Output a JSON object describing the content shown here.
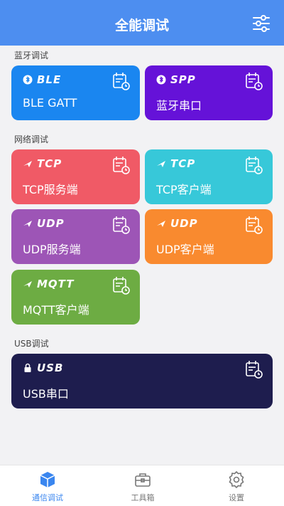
{
  "header": {
    "title": "全能调试",
    "settings_icon": "sliders-icon"
  },
  "sections": {
    "bluetooth": "蓝牙调试",
    "network": "网络调试",
    "usb": "USB调试"
  },
  "cards": [
    {
      "tag": "BLE",
      "label": "BLE GATT",
      "color": "#1a86f0",
      "icon": "bluetooth-icon"
    },
    {
      "tag": "SPP",
      "label": "蓝牙串口",
      "color": "#6512d8",
      "icon": "bluetooth-icon"
    },
    {
      "tag": "TCP",
      "label": "TCP服务端",
      "color": "#f05a66",
      "icon": "tcp-plane-icon"
    },
    {
      "tag": "TCP",
      "label": "TCP客户端",
      "color": "#37c8d9",
      "icon": "tcp-plane-icon"
    },
    {
      "tag": "UDP",
      "label": "UDP服务端",
      "color": "#9d55b6",
      "icon": "udp-plane-icon"
    },
    {
      "tag": "UDP",
      "label": "UDP客户端",
      "color": "#f98a2f",
      "icon": "udp-plane-icon"
    },
    {
      "tag": "MQTT",
      "label": "MQTT客户端",
      "color": "#6dac43",
      "icon": "mqtt-plane-icon"
    },
    {
      "tag": "USB",
      "label": "USB串口",
      "color": "#1e1d4e",
      "icon": "lock-icon"
    }
  ],
  "nav": [
    {
      "label": "通信调试",
      "active": true,
      "icon": "cube-icon"
    },
    {
      "label": "工具箱",
      "active": false,
      "icon": "toolbox-icon"
    },
    {
      "label": "设置",
      "active": false,
      "icon": "gear-icon"
    }
  ],
  "colors": {
    "header": "#4d8ef0",
    "accent": "#3a86ef",
    "background": "#f2f2f4"
  }
}
